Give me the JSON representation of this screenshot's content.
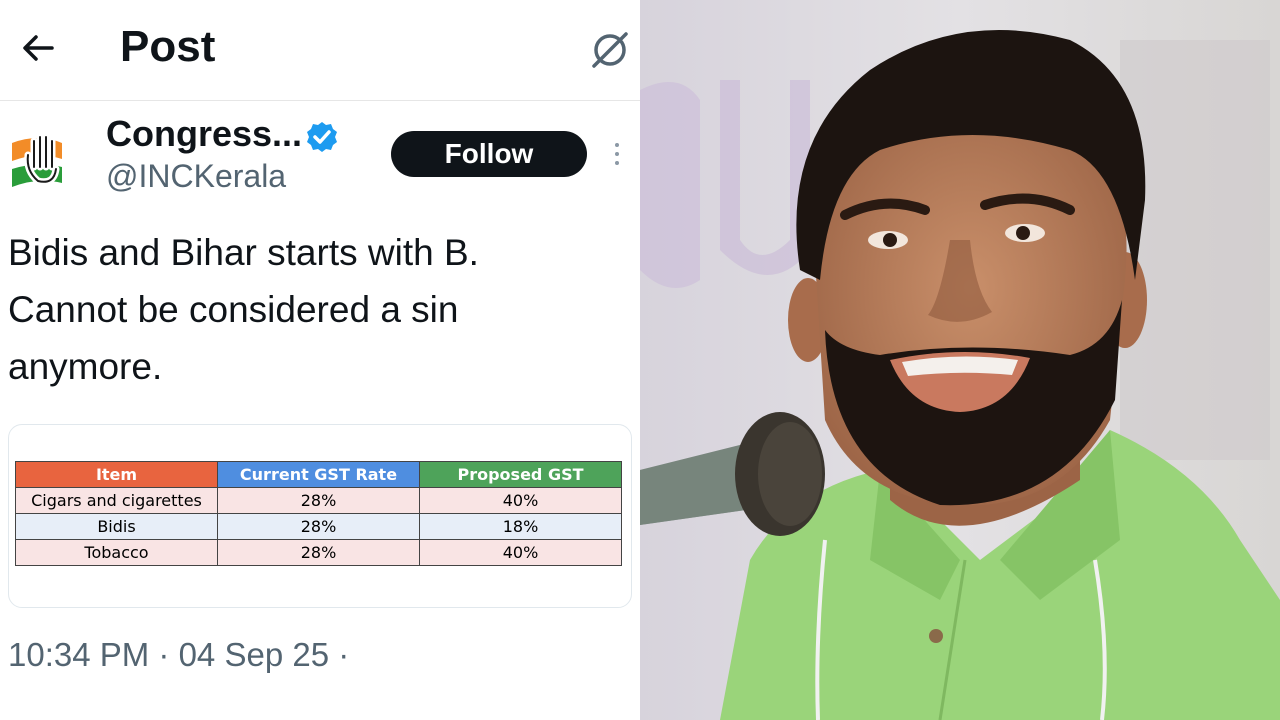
{
  "header": {
    "title": "Post"
  },
  "author": {
    "name": "Congress...",
    "handle": "@INCKerala",
    "follow_label": "Follow"
  },
  "post": {
    "lines": [
      "Bidis and Bihar starts with B.",
      "Cannot be considered a sin",
      "anymore."
    ]
  },
  "gst_table": {
    "headers": [
      "Item",
      "Current GST Rate",
      "Proposed GST"
    ],
    "header_colors": [
      "#e8643f",
      "#4f8ee0",
      "#4ea35a"
    ],
    "rows": [
      {
        "item": "Cigars and cigarettes",
        "current": "28%",
        "proposed": "40%",
        "bg": "#f9e4e4"
      },
      {
        "item": "Bidis",
        "current": "28%",
        "proposed": "18%",
        "bg": "#e7eef8"
      },
      {
        "item": "Tobacco",
        "current": "28%",
        "proposed": "40%",
        "bg": "#f9e4e4"
      }
    ]
  },
  "timestamp": "10:34 PM · 04 Sep 25 ·",
  "colors": {
    "text": "#0f1419",
    "muted": "#536471",
    "verified": "#1d9bf0",
    "shirt": "#9ad47a"
  }
}
